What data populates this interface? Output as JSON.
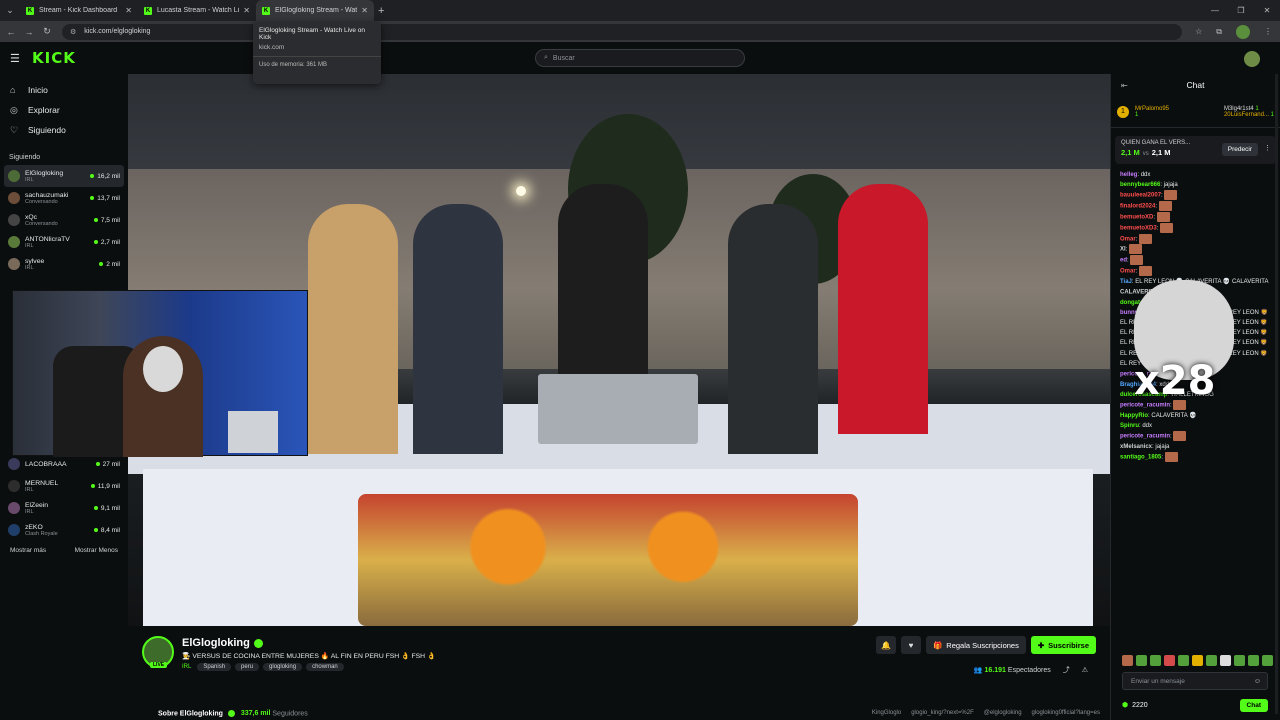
{
  "browser": {
    "tabs": [
      {
        "label": "Stream - Kick Dashboard"
      },
      {
        "label": "Lucasta Stream - Watch Live on"
      },
      {
        "label": "ElGlogloking Stream - Watch L"
      }
    ],
    "url": "kick.com/elglogloking",
    "tooltip": {
      "title": "ElGlogloking Stream - Watch Live on Kick",
      "domain": "kick.com",
      "memory": "Uso de memoria: 361 MB"
    }
  },
  "header": {
    "logo": "KICK",
    "search_placeholder": "Buscar"
  },
  "sidebar": {
    "nav": [
      {
        "label": "Inicio",
        "icon": "home-icon"
      },
      {
        "label": "Explorar",
        "icon": "compass-icon"
      },
      {
        "label": "Siguiendo",
        "icon": "heart-icon"
      }
    ],
    "following_title": "Siguiendo",
    "following": [
      {
        "name": "ElGlogloking",
        "category": "IRL",
        "viewers": "16,2 mil"
      },
      {
        "name": "sachauzumaki",
        "category": "Conversando",
        "viewers": "13,7 mil"
      },
      {
        "name": "xQc",
        "category": "Conversando",
        "viewers": "7,5 mil"
      },
      {
        "name": "ANTONlicraTV",
        "category": "IRL",
        "viewers": "2,7 mil"
      },
      {
        "name": "sylvee",
        "category": "IRL",
        "viewers": "2 mil"
      }
    ],
    "recommended": [
      {
        "name": "LACOBRAAA",
        "category": "",
        "viewers": "27 mil"
      },
      {
        "name": "MERNUEL",
        "category": "IRL",
        "viewers": "11,9 mil"
      },
      {
        "name": "ElZeein",
        "category": "IRL",
        "viewers": "9,1 mil"
      },
      {
        "name": "zEKO",
        "category": "Clash Royale",
        "viewers": "8,4 mil"
      }
    ],
    "show_more": "Mostrar más",
    "show_less": "Mostrar Menos"
  },
  "stream": {
    "channel": "ElGlogloking",
    "live_badge": "LIVE",
    "title": "🧑‍🍳 VERSUS DE COCINA ENTRE MUJERES 🔥 AL FIN EN PERU FSH 👌 FSH 👌",
    "category": "IRL",
    "tags": [
      "Spanish",
      "peru",
      "glogloking",
      "chowman"
    ],
    "gift_label": "Regala Suscripciones",
    "subscribe_label": "Suscribirse",
    "viewers": "16.191",
    "viewers_label": "Espectadores",
    "about": "Sobre ElGlogloking",
    "followers": "337,6 mil",
    "followers_label": "Seguidores",
    "socials": [
      "KingGloglo",
      "glogio_king/?next=%2F",
      "@elglogloking",
      "glogloking0fficial?lang=es"
    ]
  },
  "chat": {
    "title": "Chat",
    "leaderboard": [
      {
        "name": "MrPalomo95",
        "count": "1"
      },
      {
        "name": "M3lg4r1st4",
        "count": "1"
      },
      {
        "name": "20LuisFernand...",
        "count": "1"
      }
    ],
    "prediction": {
      "question": "QUIEN GANA EL VERS...",
      "a": "2,1 M",
      "vs": "vs",
      "b": "2,1 M",
      "button": "Predecir"
    },
    "messages": [
      {
        "user": "helleg",
        "color": "#c77dff",
        "text": "ddx"
      },
      {
        "user": "bennybear666",
        "color": "#53fc18",
        "text": "jajaja"
      },
      {
        "user": "bauuleeal2007",
        "color": "#ff4d4d",
        "text": ""
      },
      {
        "user": "finalord2024",
        "color": "#ff4d4d",
        "text": ""
      },
      {
        "user": "bemuetoXD",
        "color": "#ff4d4d",
        "text": ""
      },
      {
        "user": "bemuetoXD3",
        "color": "#ff4d4d",
        "text": ""
      },
      {
        "user": "Omar",
        "color": "#ff4d4d",
        "text": ""
      },
      {
        "user": "XI",
        "color": "#cfd1d4",
        "text": ""
      },
      {
        "user": "ed",
        "color": "#c77dff",
        "text": ""
      },
      {
        "user": "Omar",
        "color": "#ff4d4d",
        "text": ""
      },
      {
        "user": "TiaJ",
        "color": "#53a8ff",
        "text": "EL REY LEON 💀 CALAVERITA 💀 CALAVERITA"
      },
      {
        "user": "CALAVERITA",
        "color": "#cfd1d4",
        "text": ""
      },
      {
        "user": "dongato101",
        "color": "#53fc18",
        "text": "VEO UN LEON"
      },
      {
        "user": "bunnyboygamer",
        "color": "#c77dff",
        "text": "EL REY LEON 🦁 EL REY LEON 🦁 EL REY LEON 🦁 EL REY LEON 🦁 EL REY LEON 🦁 EL REY LEON 🦁 EL REY LEON 🦁 EL REY LEON 🦁 EL REY LEON 🦁 EL REY LEON 🦁 EL REY LEON 🦁 EL REY LEON 🦁 EL REY LEON 🦁 EL REY LEON 🦁 EL REY LEON 🦁"
      },
      {
        "user": "pericote_racumin",
        "color": "#c77dff",
        "text": ""
      },
      {
        "user": "Braghian_04",
        "color": "#53a8ff",
        "text": "xddd"
      },
      {
        "user": "dulcerosascamp",
        "color": "#53fc18",
        "text": "WALLETKINGG"
      },
      {
        "user": "pericote_racumin",
        "color": "#c77dff",
        "text": ""
      },
      {
        "user": "HappyRio",
        "color": "#53fc18",
        "text": "CALAVERITA 💀"
      },
      {
        "user": "Spinru",
        "color": "#53fc18",
        "text": "ddx"
      },
      {
        "user": "pericote_racumin",
        "color": "#c77dff",
        "text": ""
      },
      {
        "user": "xMelsanicx",
        "color": "#cfd1d4",
        "text": "jajaja"
      },
      {
        "user": "santiago_1805",
        "color": "#53fc18",
        "text": ""
      }
    ],
    "emote_multiplier": "x28",
    "input_placeholder": "Enviar un mensaje",
    "points": "2220",
    "send_label": "Chat"
  }
}
